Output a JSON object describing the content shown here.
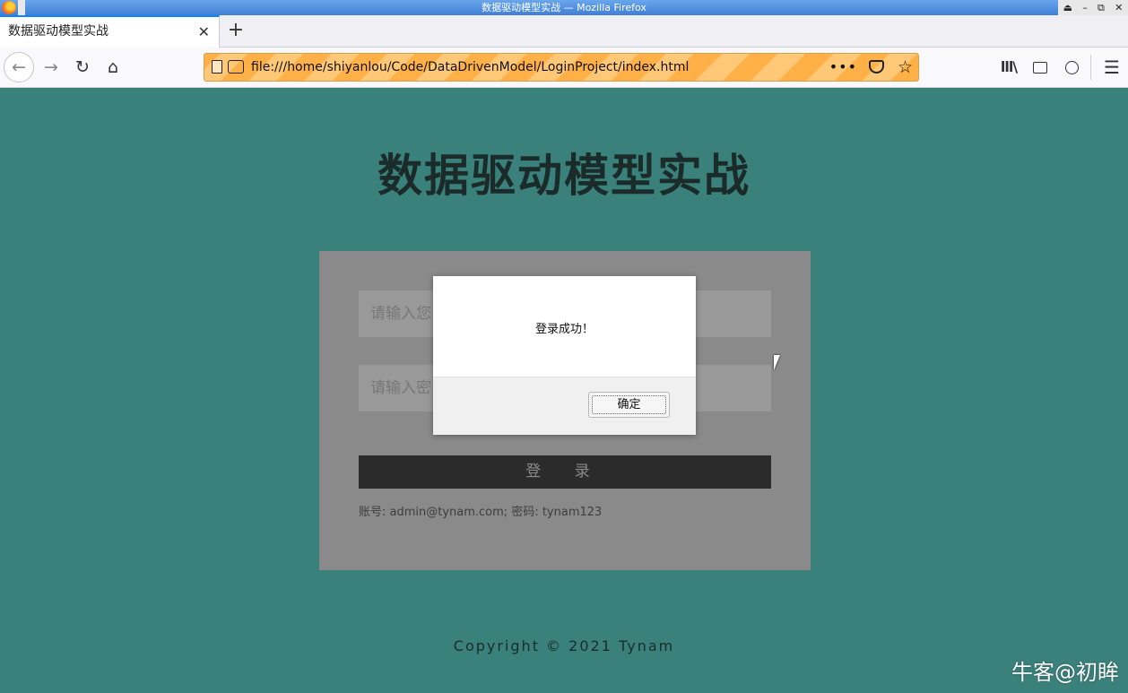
{
  "window": {
    "title": "数据驱动模型实战 — Mozilla Firefox",
    "controls": [
      "⏏",
      "–",
      "⧉",
      "✕"
    ]
  },
  "tabs": [
    {
      "label": "数据驱动模型实战",
      "close": "✕"
    }
  ],
  "new_tab_label": "+",
  "navigation": {
    "back": "←",
    "forward": "→",
    "reload": "↻",
    "home": "⌂",
    "url": "file:///home/shiyanlou/Code/DataDrivenModel/LoginProject/index.html",
    "more": "•••",
    "star": "☆",
    "library": "lll\\",
    "menu": "☰"
  },
  "page": {
    "heading": "数据驱动模型实战",
    "username_placeholder": "请输入您",
    "password_placeholder": "请输入密",
    "login_button": "登 录",
    "hint": "账号: admin@tynam.com; 密码: tynam123",
    "copyright": "Copyright © 2021 Tynam"
  },
  "dialog": {
    "message": "登录成功！",
    "ok_button": "确定"
  },
  "watermark": "牛客@初眸",
  "colors": {
    "page_background": "#3a817c",
    "panel_background": "#8a8a8a",
    "url_highlight": "#ffb046"
  }
}
